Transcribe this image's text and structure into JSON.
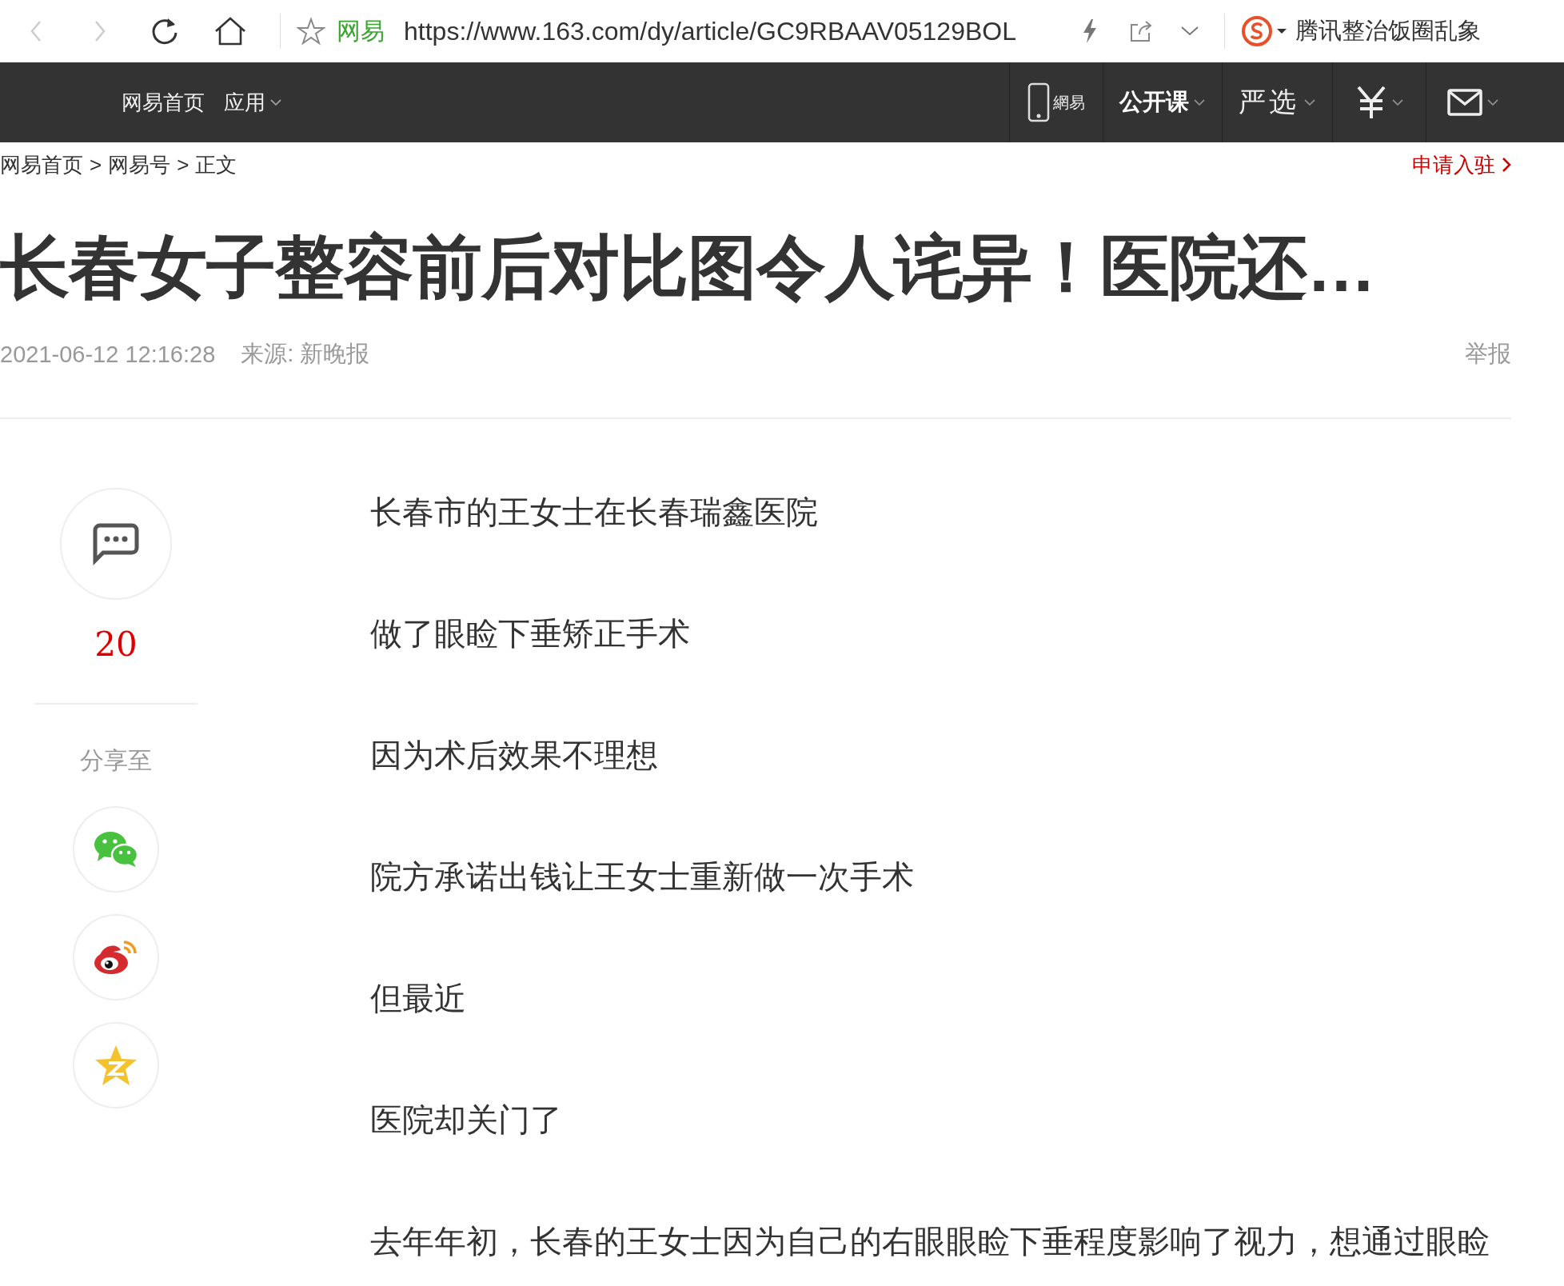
{
  "browser": {
    "nav_buttons": [
      {
        "kind": "back",
        "disabled": true
      },
      {
        "kind": "forward",
        "disabled": true
      }
    ],
    "site_label": "网易",
    "url": "https://www.163.com/dy/article/GC9RBAAV05129BOL",
    "search_suggestion": "腾讯整治饭圈乱象"
  },
  "site_nav": {
    "left": [
      {
        "label": "网易首页",
        "dropdown": false
      },
      {
        "label": "应用",
        "dropdown": true
      }
    ],
    "right": [
      {
        "kind": "app",
        "label": "網易"
      },
      {
        "kind": "text",
        "label": "公开课"
      },
      {
        "kind": "brush",
        "label": "严选"
      },
      {
        "kind": "yen"
      },
      {
        "kind": "mail"
      }
    ]
  },
  "breadcrumb": {
    "separator": ">",
    "items": [
      "网易首页",
      "网易号",
      "正文"
    ]
  },
  "apply_link": "申请入驻",
  "article": {
    "title": "长春女子整容前后对比图令人诧异！医院还…",
    "date": "2021-06-12 12:16:28",
    "source": "来源: 新晚报",
    "report": "举报",
    "paragraphs": [
      "长春市的王女士在长春瑞鑫医院",
      "做了眼睑下垂矫正手术",
      "因为术后效果不理想",
      "院方承诺出钱让王女士重新做一次手术",
      "但最近",
      "医院却关门了",
      "去年年初，长春的王女士因为自己的右眼眼睑下垂程度影响了视力，想通过眼睑"
    ]
  },
  "sidebar": {
    "comment_count": "20",
    "share_label": "分享至",
    "share": [
      {
        "kind": "wechat"
      },
      {
        "kind": "weibo"
      },
      {
        "kind": "qzone"
      }
    ]
  }
}
